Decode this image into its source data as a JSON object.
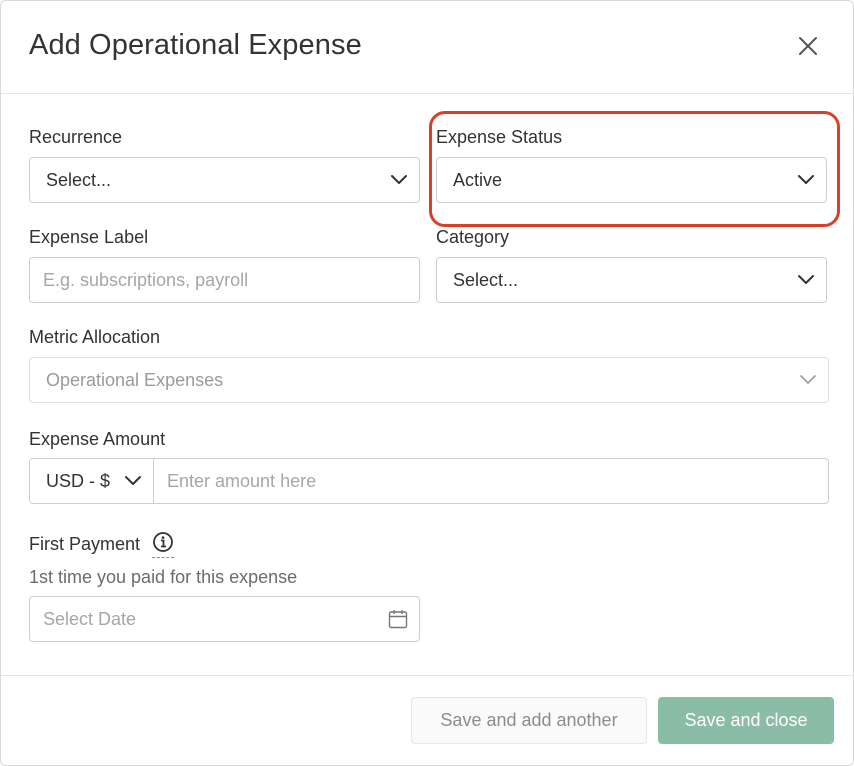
{
  "dialog": {
    "title": "Add Operational Expense",
    "close_icon": "close-icon"
  },
  "form": {
    "recurrence": {
      "label": "Recurrence",
      "value": "Select..."
    },
    "expense_status": {
      "label": "Expense Status",
      "value": "Active"
    },
    "expense_label": {
      "label": "Expense Label",
      "placeholder": "E.g. subscriptions, payroll",
      "value": ""
    },
    "category": {
      "label": "Category",
      "value": "Select..."
    },
    "metric_allocation": {
      "label": "Metric Allocation",
      "value": "Operational Expenses"
    },
    "expense_amount": {
      "label": "Expense Amount",
      "currency": "USD - $",
      "placeholder": "Enter amount here",
      "value": ""
    },
    "first_payment": {
      "label": "First Payment",
      "help_text": "1st time you paid for this expense",
      "placeholder": "Select Date",
      "info_icon": "info-icon",
      "calendar_icon": "calendar-icon"
    }
  },
  "footer": {
    "secondary_button": "Save and add another",
    "primary_button": "Save and close"
  },
  "colors": {
    "primary_button": "#8bbca6",
    "highlight_annotation": "#d9402b",
    "border": "#cfcfcf",
    "placeholder": "#a6a6a6"
  }
}
